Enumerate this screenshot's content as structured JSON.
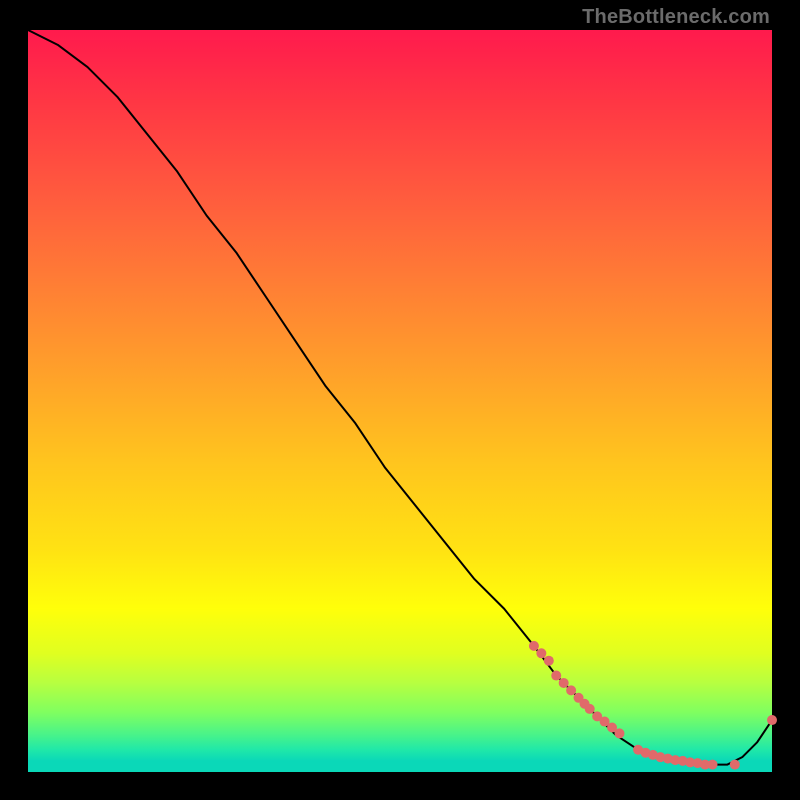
{
  "watermark": "TheBottleneck.com",
  "chart_data": {
    "type": "line",
    "title": "",
    "xlabel": "",
    "ylabel": "",
    "xlim": [
      0,
      100
    ],
    "ylim": [
      0,
      100
    ],
    "background_gradient": {
      "top_color": "#ff1a4d",
      "mid_color": "#ffff0a",
      "bottom_color": "#0ad8b8"
    },
    "series": [
      {
        "name": "bottleneck-curve",
        "color": "#000000",
        "x": [
          0,
          4,
          8,
          12,
          16,
          20,
          24,
          28,
          32,
          36,
          40,
          44,
          48,
          52,
          56,
          60,
          64,
          68,
          71,
          74,
          76,
          79,
          82,
          85,
          88,
          91,
          94,
          96,
          98,
          100
        ],
        "values": [
          100,
          98,
          95,
          91,
          86,
          81,
          75,
          70,
          64,
          58,
          52,
          47,
          41,
          36,
          31,
          26,
          22,
          17,
          13,
          10,
          8,
          5,
          3,
          2,
          1.5,
          1,
          1,
          2,
          4,
          7
        ]
      }
    ],
    "markers": [
      {
        "name": "highlight-points",
        "color": "#e06a6a",
        "radius": 5,
        "x": [
          68,
          69,
          70,
          71,
          72,
          73,
          74,
          74.8,
          75.5,
          76.5,
          77.5,
          78.5,
          79.5,
          82,
          83,
          84,
          85,
          86,
          87,
          88,
          89,
          90,
          91,
          92,
          95,
          100
        ],
        "values": [
          17,
          16,
          15,
          13,
          12,
          11,
          10,
          9.2,
          8.5,
          7.5,
          6.8,
          6.0,
          5.2,
          3,
          2.6,
          2.3,
          2.0,
          1.8,
          1.6,
          1.5,
          1.3,
          1.2,
          1.0,
          1.0,
          1.0,
          7
        ]
      }
    ]
  }
}
